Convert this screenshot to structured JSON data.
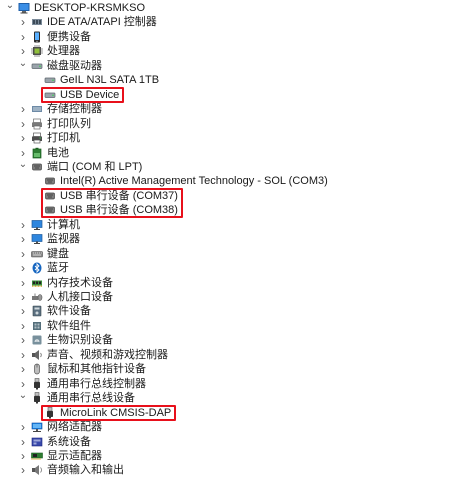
{
  "computer_name": "DESKTOP-KRSMKSO",
  "tree": [
    {
      "id": "computer",
      "level": 0,
      "state": "expanded",
      "icon": "computer-icon",
      "label": "DESKTOP-KRSMKSO"
    },
    {
      "id": "ide",
      "level": 1,
      "state": "collapsed",
      "icon": "ide-controller-icon",
      "label": "IDE ATA/ATAPI 控制器"
    },
    {
      "id": "portable",
      "level": 1,
      "state": "collapsed",
      "icon": "portable-device-icon",
      "label": "便携设备"
    },
    {
      "id": "processor",
      "level": 1,
      "state": "collapsed",
      "icon": "processor-icon",
      "label": "处理器"
    },
    {
      "id": "disk-drives",
      "level": 1,
      "state": "expanded",
      "icon": "disk-drive-icon",
      "label": "磁盘驱动器"
    },
    {
      "id": "disk-geil",
      "level": 2,
      "state": "leaf",
      "icon": "disk-drive-icon",
      "label": "GeIL N3L SATA 1TB"
    },
    {
      "id": "disk-usb",
      "level": 2,
      "state": "leaf",
      "icon": "disk-drive-icon",
      "label": "USB Device"
    },
    {
      "id": "storage-ctrl",
      "level": 1,
      "state": "collapsed",
      "icon": "storage-controller-icon",
      "label": "存储控制器"
    },
    {
      "id": "print-queue",
      "level": 1,
      "state": "collapsed",
      "icon": "print-queue-icon",
      "label": "打印队列"
    },
    {
      "id": "printer",
      "level": 1,
      "state": "collapsed",
      "icon": "printer-icon",
      "label": "打印机"
    },
    {
      "id": "battery",
      "level": 1,
      "state": "collapsed",
      "icon": "battery-icon",
      "label": "电池"
    },
    {
      "id": "ports",
      "level": 1,
      "state": "expanded",
      "icon": "port-icon",
      "label": "端口 (COM 和 LPT)"
    },
    {
      "id": "port-intel",
      "level": 2,
      "state": "leaf",
      "icon": "port-icon",
      "label": "Intel(R) Active Management Technology - SOL (COM3)"
    },
    {
      "id": "port-com37",
      "level": 2,
      "state": "leaf",
      "icon": "port-icon",
      "label": "USB 串行设备 (COM37)"
    },
    {
      "id": "port-com38",
      "level": 2,
      "state": "leaf",
      "icon": "port-icon",
      "label": "USB 串行设备 (COM38)"
    },
    {
      "id": "computer-cat",
      "level": 1,
      "state": "collapsed",
      "icon": "monitor-icon",
      "label": "计算机"
    },
    {
      "id": "monitors",
      "level": 1,
      "state": "collapsed",
      "icon": "monitor-icon",
      "label": "监视器"
    },
    {
      "id": "keyboards",
      "level": 1,
      "state": "collapsed",
      "icon": "keyboard-icon",
      "label": "键盘"
    },
    {
      "id": "bluetooth",
      "level": 1,
      "state": "collapsed",
      "icon": "bluetooth-icon",
      "label": "蓝牙"
    },
    {
      "id": "memory-tech",
      "level": 1,
      "state": "collapsed",
      "icon": "memory-icon",
      "label": "内存技术设备"
    },
    {
      "id": "hid",
      "level": 1,
      "state": "collapsed",
      "icon": "hid-icon",
      "label": "人机接口设备"
    },
    {
      "id": "software-dev",
      "level": 1,
      "state": "collapsed",
      "icon": "software-device-icon",
      "label": "软件设备"
    },
    {
      "id": "software-comp",
      "level": 1,
      "state": "collapsed",
      "icon": "software-component-icon",
      "label": "软件组件"
    },
    {
      "id": "biometric",
      "level": 1,
      "state": "collapsed",
      "icon": "biometric-icon",
      "label": "生物识别设备"
    },
    {
      "id": "sound",
      "level": 1,
      "state": "collapsed",
      "icon": "speaker-icon",
      "label": "声音、视频和游戏控制器"
    },
    {
      "id": "mouse",
      "level": 1,
      "state": "collapsed",
      "icon": "mouse-icon",
      "label": "鼠标和其他指针设备"
    },
    {
      "id": "usb-ctrl",
      "level": 1,
      "state": "collapsed",
      "icon": "usb-icon",
      "label": "通用串行总线控制器"
    },
    {
      "id": "usb-dev",
      "level": 1,
      "state": "expanded",
      "icon": "usb-icon",
      "label": "通用串行总线设备"
    },
    {
      "id": "microlink",
      "level": 2,
      "state": "leaf",
      "icon": "usb-icon",
      "label": "MicroLink CMSIS-DAP"
    },
    {
      "id": "network",
      "level": 1,
      "state": "collapsed",
      "icon": "network-adapter-icon",
      "label": "网络适配器"
    },
    {
      "id": "system",
      "level": 1,
      "state": "collapsed",
      "icon": "system-device-icon",
      "label": "系统设备"
    },
    {
      "id": "display",
      "level": 1,
      "state": "collapsed",
      "icon": "display-adapter-icon",
      "label": "显示适配器"
    },
    {
      "id": "audio-io",
      "level": 1,
      "state": "collapsed",
      "icon": "audio-io-icon",
      "label": "音频输入和输出"
    }
  ],
  "highlights": [
    {
      "id": "hl-usb-device",
      "targets": [
        "disk-usb"
      ]
    },
    {
      "id": "hl-com-ports",
      "targets": [
        "port-com37",
        "port-com38"
      ]
    },
    {
      "id": "hl-microlink",
      "targets": [
        "microlink"
      ]
    }
  ],
  "colors": {
    "highlight": "#e8101b",
    "text": "#1a1a1a",
    "chevron": "#555555"
  }
}
